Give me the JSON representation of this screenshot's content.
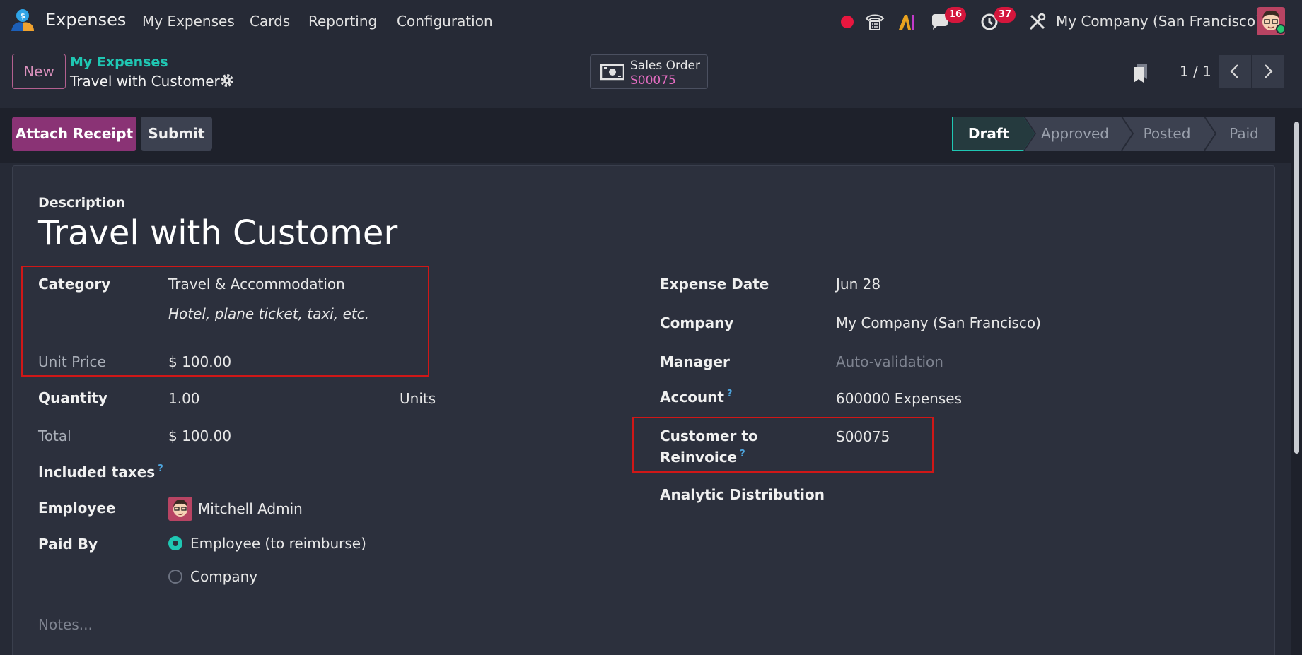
{
  "navbar": {
    "app_title": "Expenses",
    "menu": [
      "My Expenses",
      "Cards",
      "Reporting",
      "Configuration"
    ],
    "messages_badge": "16",
    "activities_badge": "37",
    "company": "My Company (San Francisco)",
    "icons": [
      "expenses-app-icon",
      "record-dot-icon",
      "phone-icon",
      "ai-icon",
      "chat-icon",
      "clock-icon",
      "tools-icon",
      "user-avatar"
    ]
  },
  "control_panel": {
    "new_label": "New",
    "breadcrumb_parent": "My Expenses",
    "breadcrumb_current": "Travel with Customer",
    "smart_button": {
      "label": "Sales Order",
      "value": "S00075"
    },
    "pager": "1 / 1"
  },
  "statusbar": {
    "attach_receipt": "Attach Receipt",
    "submit": "Submit",
    "stages": [
      "Draft",
      "Approved",
      "Posted",
      "Paid"
    ],
    "active_stage": "Draft"
  },
  "form": {
    "description_label": "Description",
    "title": "Travel with Customer",
    "left": {
      "category_label": "Category",
      "category_value": "Travel & Accommodation",
      "category_note": "Hotel, plane ticket, taxi, etc.",
      "unit_price_label": "Unit Price",
      "unit_price_value": "$ 100.00",
      "quantity_label": "Quantity",
      "quantity_value": "1.00",
      "quantity_uom": "Units",
      "total_label": "Total",
      "total_value": "$ 100.00",
      "included_taxes_label": "Included taxes",
      "employee_label": "Employee",
      "employee_value": "Mitchell Admin",
      "paid_by_label": "Paid By",
      "paid_by_options": [
        "Employee (to reimburse)",
        "Company"
      ],
      "notes_placeholder": "Notes..."
    },
    "right": {
      "expense_date_label": "Expense Date",
      "expense_date_value": "Jun 28",
      "company_label": "Company",
      "company_value": "My Company (San Francisco)",
      "manager_label": "Manager",
      "manager_placeholder": "Auto-validation",
      "account_label": "Account",
      "account_value": "600000 Expenses",
      "customer_label_1": "Customer to",
      "customer_label_2": "Reinvoice",
      "customer_value": "S00075",
      "analytic_label": "Analytic Distribution"
    },
    "help_mark": "?"
  },
  "colors": {
    "accent_teal": "#1FC7B3",
    "primary_purple": "#8A3375",
    "highlight_red": "#D01717"
  }
}
